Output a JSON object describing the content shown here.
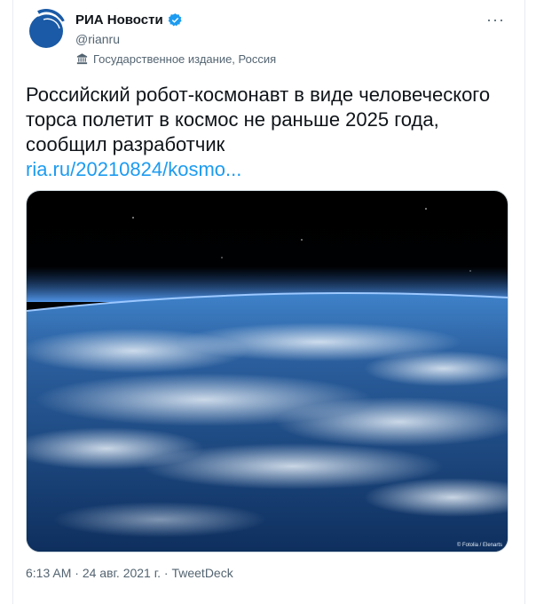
{
  "author": {
    "display_name": "РИА Новости",
    "handle": "@rianru",
    "label": "Государственное издание, Россия"
  },
  "tweet": {
    "text": "Российский робот-космонавт в виде человеческого торса полетит в космос не раньше 2025 года, сообщил разработчик",
    "link": "ria.ru/20210824/kosmo..."
  },
  "media": {
    "credit": "© Fotolia / Elenarts"
  },
  "meta": {
    "time": "6:13 AM",
    "date": "24 авг. 2021 г.",
    "source": "TweetDeck"
  },
  "icons": {
    "more": "more-options-icon",
    "verified": "verified-badge-icon",
    "label": "state-media-icon"
  },
  "colors": {
    "link": "#1d9bf0",
    "verified": "#1d9bf0",
    "secondary_text": "#536471",
    "logo": "#1a5aa6"
  }
}
